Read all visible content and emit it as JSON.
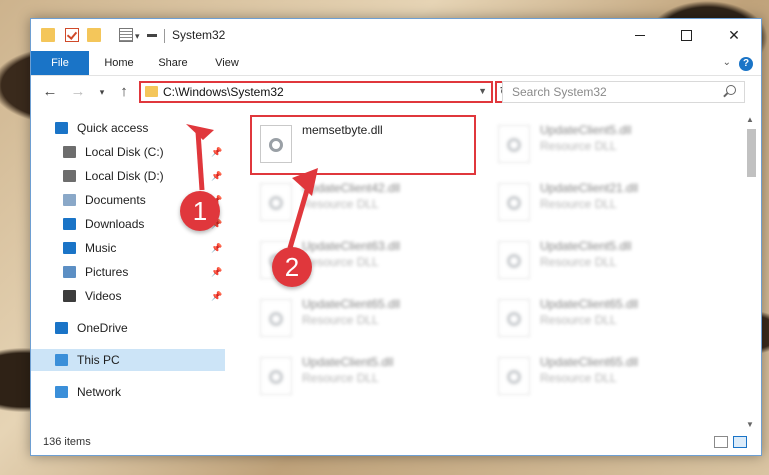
{
  "window": {
    "title": "System32",
    "controls": {
      "minimize": "minimize",
      "maximize": "maximize",
      "close": "✕"
    }
  },
  "ribbon": {
    "tabs": [
      "File",
      "Home",
      "Share",
      "View"
    ],
    "help": "?"
  },
  "address": {
    "path": "C:\\Windows\\System32",
    "search_placeholder": "Search System32"
  },
  "nav": {
    "items": [
      {
        "label": "Quick access",
        "icon": "star-icon",
        "color": "#1a74c7"
      },
      {
        "label": "Local Disk (C:)",
        "icon": "drive-icon",
        "color": "#6d6d6d",
        "pinned": true
      },
      {
        "label": "Local Disk (D:)",
        "icon": "drive-icon",
        "color": "#6d6d6d",
        "pinned": true
      },
      {
        "label": "Documents",
        "icon": "documents-icon",
        "color": "#8aa8c8",
        "pinned": true
      },
      {
        "label": "Downloads",
        "icon": "download-icon",
        "color": "#1a74c7",
        "pinned": true
      },
      {
        "label": "Music",
        "icon": "music-icon",
        "color": "#1a74c7",
        "pinned": true
      },
      {
        "label": "Pictures",
        "icon": "pictures-icon",
        "color": "#5c8fc4",
        "pinned": true
      },
      {
        "label": "Videos",
        "icon": "videos-icon",
        "color": "#3c3c3c",
        "pinned": true
      },
      {
        "label": "OneDrive",
        "icon": "cloud-icon",
        "color": "#1a74c7"
      },
      {
        "label": "This PC",
        "icon": "computer-icon",
        "color": "#3b8fd9",
        "selected": true
      },
      {
        "label": "Network",
        "icon": "network-icon",
        "color": "#3b8fd9"
      }
    ]
  },
  "files": [
    {
      "name": "memsetbyte.dll",
      "type": "",
      "highlighted": true
    },
    {
      "name": "UpdateClient5.dll",
      "type": "Resource DLL"
    },
    {
      "name": "UpdateClient42.dll",
      "type": "Resource DLL"
    },
    {
      "name": "UpdateClient21.dll",
      "type": "Resource DLL"
    },
    {
      "name": "UpdateClient63.dll",
      "type": "Resource DLL"
    },
    {
      "name": "UpdateClient5.dll",
      "type": "Resource DLL"
    },
    {
      "name": "UpdateClient65.dll",
      "type": "Resource DLL"
    },
    {
      "name": "UpdateClient65.dll",
      "type": "Resource DLL"
    },
    {
      "name": "UpdateClient5.dll",
      "type": "Resource DLL"
    },
    {
      "name": "UpdateClient65.dll",
      "type": "Resource DLL"
    }
  ],
  "status": {
    "count": "136 items"
  },
  "callouts": [
    "1",
    "2"
  ],
  "colors": {
    "accent": "#1a74c7",
    "highlight": "#e0373c",
    "selected": "#cce4f7"
  }
}
